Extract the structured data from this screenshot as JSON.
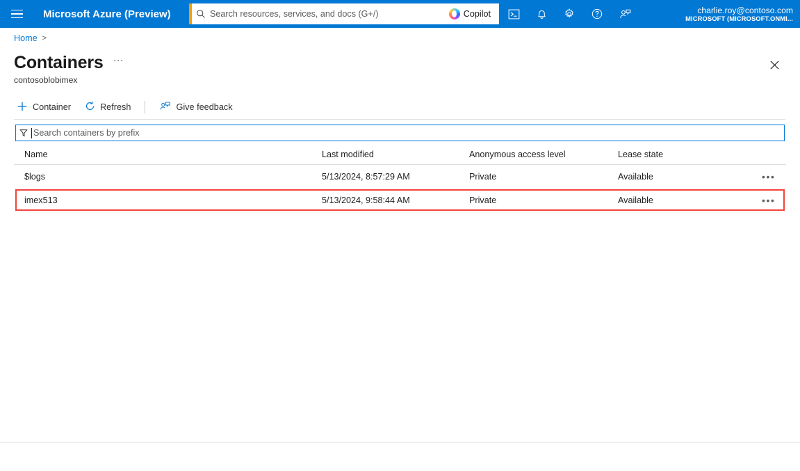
{
  "topbar": {
    "menu_icon": "hamburger-icon",
    "brand": "Microsoft Azure (Preview)",
    "search": {
      "icon": "search-icon",
      "placeholder": "Search resources, services, and docs (G+/)",
      "value": ""
    },
    "copilot": {
      "label": "Copilot",
      "icon": "copilot-icon"
    },
    "icons": [
      {
        "name": "cloud-shell-icon",
        "glyph": "terminal"
      },
      {
        "name": "notifications-icon",
        "glyph": "bell"
      },
      {
        "name": "settings-icon",
        "glyph": "gear"
      },
      {
        "name": "help-icon",
        "glyph": "question-circle"
      },
      {
        "name": "feedback-icon",
        "glyph": "person-speech"
      }
    ],
    "user": {
      "email": "charlie.roy@contoso.com",
      "tenant": "MICROSOFT (MICROSOFT.ONMI..."
    }
  },
  "breadcrumb": {
    "items": [
      {
        "label": "Home"
      }
    ],
    "separator": ">"
  },
  "page": {
    "title": "Containers",
    "title_more": "···",
    "subtitle": "contosoblobimex",
    "close_label": "Close"
  },
  "commandbar": {
    "buttons": [
      {
        "label": "Container",
        "icon": "plus-icon"
      },
      {
        "label": "Refresh",
        "icon": "refresh-icon"
      },
      {
        "label": "Give feedback",
        "icon": "feedback-person-icon"
      }
    ]
  },
  "filter": {
    "icon": "funnel-icon",
    "placeholder": "Search containers by prefix",
    "value": ""
  },
  "table": {
    "columns": [
      "Name",
      "Last modified",
      "Anonymous access level",
      "Lease state"
    ],
    "rows": [
      {
        "name": "$logs",
        "last_modified": "5/13/2024, 8:57:29 AM",
        "anonymous_access_level": "Private",
        "lease_state": "Available",
        "more_label": "•••",
        "highlighted": false
      },
      {
        "name": "imex513",
        "last_modified": "5/13/2024, 9:58:44 AM",
        "anonymous_access_level": "Private",
        "lease_state": "Available",
        "more_label": "•••",
        "highlighted": true
      }
    ]
  },
  "colors": {
    "azure_blue": "#0078d4",
    "accent_orange": "#f2a000",
    "highlight_red": "#f4433c",
    "text_primary": "#201f1e"
  }
}
